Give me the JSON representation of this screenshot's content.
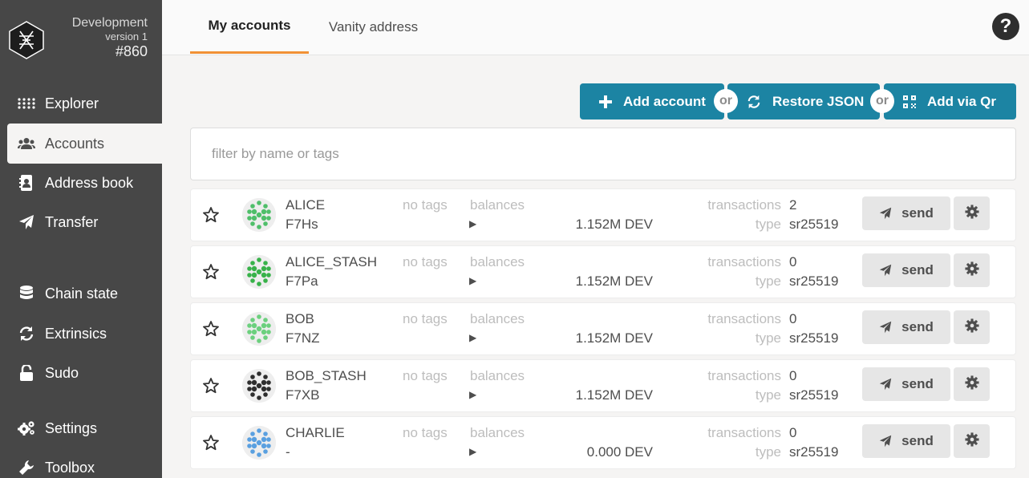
{
  "build": {
    "chain": "Development",
    "version": "version 1",
    "block": "#860"
  },
  "sidebar": {
    "items": [
      {
        "label": "Explorer",
        "icon": "grid-dots-icon"
      },
      {
        "label": "Accounts",
        "icon": "users-icon",
        "active": true
      },
      {
        "label": "Address book",
        "icon": "address-book-icon"
      },
      {
        "label": "Transfer",
        "icon": "paper-plane-icon"
      },
      {
        "label": "Chain state",
        "icon": "database-icon"
      },
      {
        "label": "Extrinsics",
        "icon": "sync-icon"
      },
      {
        "label": "Sudo",
        "icon": "unlock-icon"
      },
      {
        "label": "Settings",
        "icon": "cogs-icon"
      },
      {
        "label": "Toolbox",
        "icon": "wrench-icon"
      }
    ]
  },
  "tabs": [
    {
      "label": "My accounts",
      "active": true
    },
    {
      "label": "Vanity address"
    }
  ],
  "help": {
    "label": "?"
  },
  "actions": {
    "add_account": "Add account",
    "restore_json": "Restore JSON",
    "add_via_qr": "Add via Qr",
    "or": "or"
  },
  "filter": {
    "placeholder": "filter by name or tags",
    "value": ""
  },
  "labels": {
    "no_tags": "no tags",
    "balances": "balances",
    "transactions": "transactions",
    "type": "type",
    "send": "send"
  },
  "accounts": [
    {
      "name": "ALICE",
      "address": "F7Hs",
      "balance": "1.152M DEV",
      "transactions": "2",
      "type": "sr25519",
      "color": "#4fbf6a"
    },
    {
      "name": "ALICE_STASH",
      "address": "F7Pa",
      "balance": "1.152M DEV",
      "transactions": "0",
      "type": "sr25519",
      "color": "#38b24a"
    },
    {
      "name": "BOB",
      "address": "F7NZ",
      "balance": "1.152M DEV",
      "transactions": "0",
      "type": "sr25519",
      "color": "#6cd07e"
    },
    {
      "name": "BOB_STASH",
      "address": "F7XB",
      "balance": "1.152M DEV",
      "transactions": "0",
      "type": "sr25519",
      "color": "#2e2e2e"
    },
    {
      "name": "CHARLIE",
      "address": "-",
      "balance": "0.000 DEV",
      "transactions": "0",
      "type": "sr25519",
      "color": "#5aa0e0"
    }
  ],
  "colors": {
    "accent": "#f19135",
    "button": "#1c84a3",
    "sidebar": "#474747"
  }
}
